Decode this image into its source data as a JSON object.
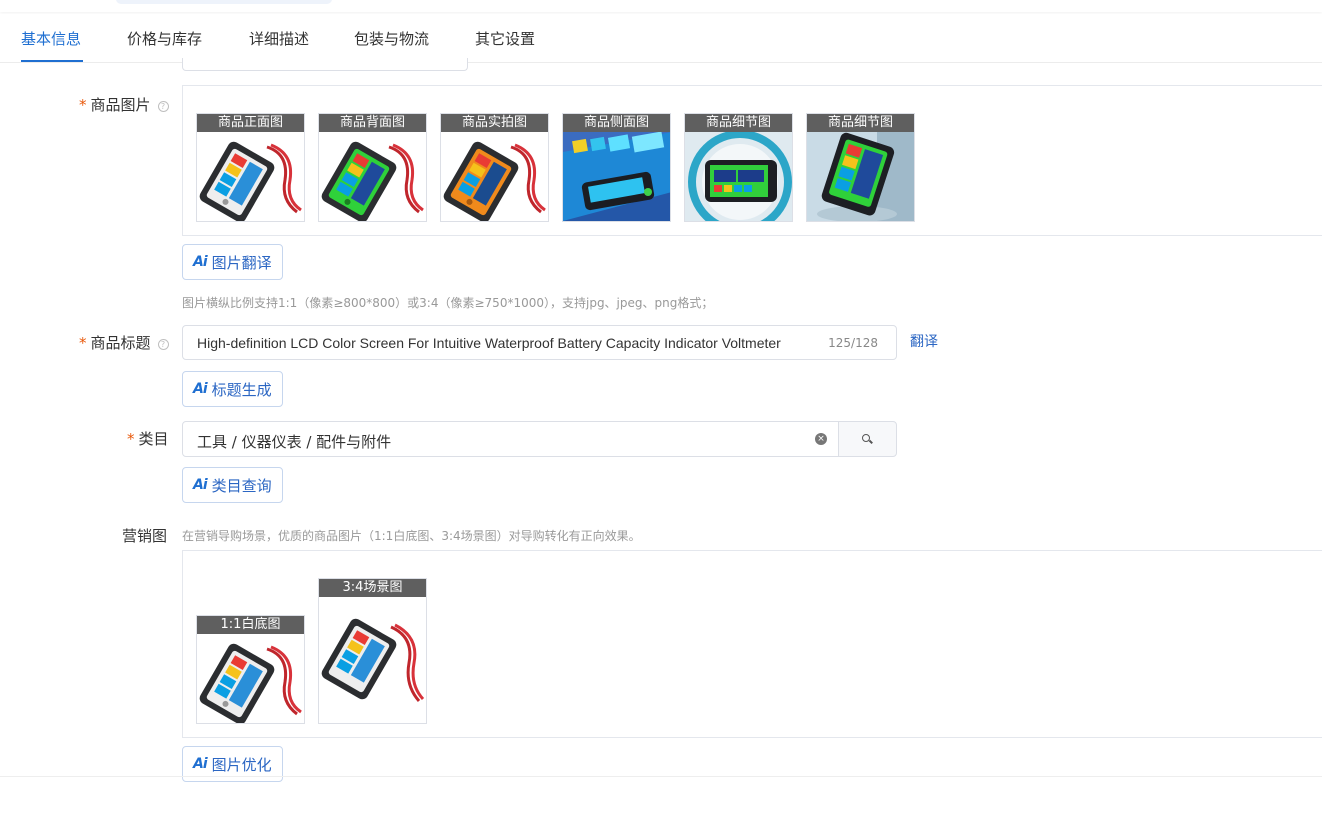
{
  "tabs": [
    {
      "label": "基本信息",
      "active": true
    },
    {
      "label": "价格与库存",
      "active": false
    },
    {
      "label": "详细描述",
      "active": false
    },
    {
      "label": "包装与物流",
      "active": false
    },
    {
      "label": "其它设置",
      "active": false
    }
  ],
  "required_mark": "*",
  "help_glyph": "?",
  "product_images": {
    "label": "商品图片",
    "images": [
      {
        "caption": "商品正面图",
        "variant": "white-screen"
      },
      {
        "caption": "商品背面图",
        "variant": "green-screen"
      },
      {
        "caption": "商品实拍图",
        "variant": "orange-screen"
      },
      {
        "caption": "商品侧面图",
        "variant": "blue-closeup"
      },
      {
        "caption": "商品细节图",
        "variant": "gauge"
      },
      {
        "caption": "商品细节图",
        "variant": "green-tilt"
      }
    ],
    "ai_button": "图片翻译",
    "hint": "图片横纵比例支持1:1（像素≥800*800）或3:4（像素≥750*1000），支持jpg、jpeg、png格式；"
  },
  "product_title": {
    "label": "商品标题",
    "value": "High-definition LCD Color Screen For Intuitive Waterproof Battery Capacity Indicator Voltmeter",
    "count": "125/128",
    "translate_link": "翻译",
    "ai_button": "标题生成"
  },
  "category": {
    "label": "类目",
    "value": "工具 / 仪器仪表 / 配件与附件",
    "clear_glyph": "×",
    "ai_button": "类目查询"
  },
  "marketing": {
    "label": "营销图",
    "hint": "在营销导购场景，优质的商品图片（1:1白底图、3:4场景图）对导购转化有正向效果。",
    "images": [
      {
        "caption": "1:1白底图"
      },
      {
        "caption": "3:4场景图"
      }
    ],
    "ai_button": "图片优化"
  },
  "ai_icon_text": "Ai",
  "colors": {
    "accent": "#1f6fd1",
    "required": "#e8590c",
    "caption_bg": "#5f5f5f"
  }
}
